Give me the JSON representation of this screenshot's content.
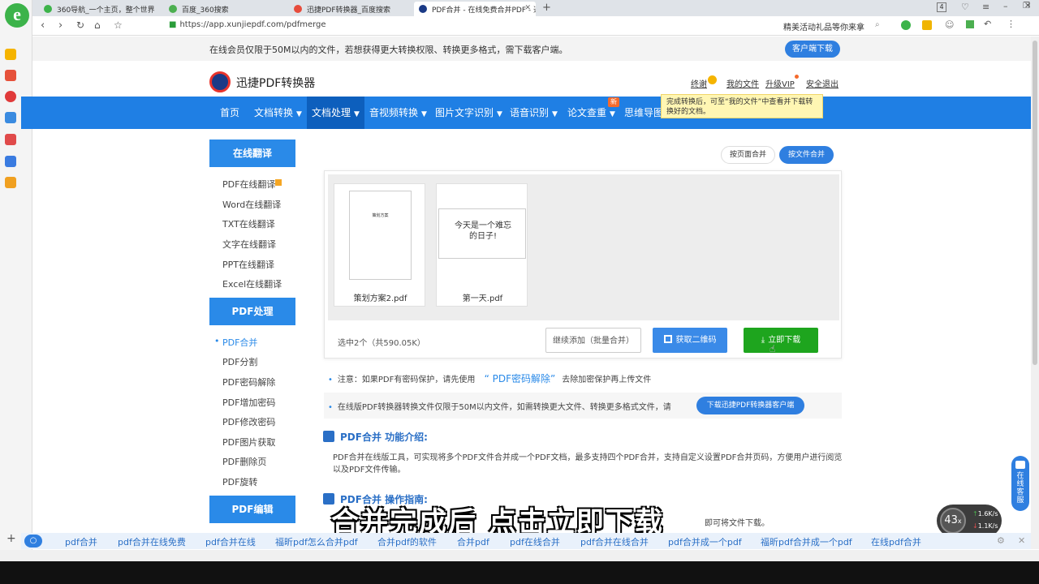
{
  "browser": {
    "tabs": [
      {
        "label": "360导航_一个主页，整个世界",
        "active": false
      },
      {
        "label": "百度_360搜索",
        "active": false
      },
      {
        "label": "迅捷PDF转换器_百度搜索",
        "active": false
      },
      {
        "label": "PDF合并 - 在线免费合并PDF - 迅",
        "active": true
      }
    ],
    "url": "https://app.xunjiepdf.com/pdfmerge",
    "right_text": "精美活动礼品等你来拿",
    "tab_count": "4"
  },
  "notice": {
    "text": "在线会员仅限于50M以内的文件，若想获得更大转换权限、转换更多格式，需下载客户端。",
    "button": "客户端下载"
  },
  "header": {
    "logo_text": "迅捷PDF转换器",
    "links": [
      "终谢",
      "我的文件",
      "升级VIP",
      "安全退出"
    ],
    "tooltip": "完成转换后，可至“我的文件”中查看并下载转换好的文档。"
  },
  "nav": {
    "items": [
      {
        "label": "首页",
        "caret": false
      },
      {
        "label": "文档转换",
        "caret": true
      },
      {
        "label": "文档处理",
        "caret": true
      },
      {
        "label": "音视频转换",
        "caret": true
      },
      {
        "label": "图片文字识别",
        "caret": true
      },
      {
        "label": "语音识别",
        "caret": true
      },
      {
        "label": "论文查重",
        "caret": true
      },
      {
        "label": "思维导图",
        "caret": false
      }
    ],
    "badge": "新"
  },
  "sidebar": {
    "sections": [
      {
        "title": "在线翻译",
        "items": [
          "PDF在线翻译",
          "Word在线翻译",
          "TXT在线翻译",
          "文字在线翻译",
          "PPT在线翻译",
          "Excel在线翻译"
        ]
      },
      {
        "title": "PDF处理",
        "items": [
          "PDF合并",
          "PDF分割",
          "PDF密码解除",
          "PDF增加密码",
          "PDF修改密码",
          "PDF图片获取",
          "PDF删除页",
          "PDF旋转"
        ]
      },
      {
        "title": "PDF编辑",
        "items": []
      }
    ],
    "active_item": "PDF合并"
  },
  "main": {
    "modes": [
      "按页面合并",
      "按文件合并"
    ],
    "files": [
      {
        "name": "策划方案2.pdf",
        "thumb_text": "策划方案"
      },
      {
        "name": "第一天.pdf",
        "thumb_text": "今天是一个难忘的日子!"
      }
    ],
    "selection_info": "选中2个（共590.05K）",
    "buttons": {
      "continue_add": "继续添加（批量合并）",
      "qr": "获取二维码",
      "download": "立即下载"
    },
    "note1_prefix": "注意：如果PDF有密码保护，请先使用",
    "note1_link": "“ PDF密码解除”",
    "note1_suffix": "去除加密保护再上传文件",
    "note2": "在线版PDF转换器转换文件仅限于50M以内文件，如需转换更大文件、转换更多格式文件，请",
    "note2_button": "下载迅捷PDF转换器客户端",
    "section1_title": "PDF合并 功能介绍:",
    "section1_body": "PDF合并在线版工具，可实现将多个PDF文件合并成一个PDF文档，最多支持四个PDF合并，支持自定义设置PDF合并页码，方便用户进行阅览以及PDF文件传输。",
    "section2_title": "PDF合并 操作指南:",
    "section2_body_partial": "即可将文件下载。"
  },
  "subtitle": "合并完成后 点击立即下载",
  "float": {
    "service": "在线客服",
    "speed_pct": "43",
    "speed_unit": "x",
    "up": "1.6K/s",
    "down": "1.1K/s"
  },
  "search_keywords": [
    "pdf合并",
    "pdf合并在线免费",
    "pdf合并在线",
    "福昕pdf怎么合并pdf",
    "合并pdf的软件",
    "合并pdf",
    "pdf在线合并",
    "pdf合并在线合并",
    "pdf合并成一个pdf",
    "福昕pdf合并成一个pdf",
    "在线pdf合并"
  ],
  "colors": {
    "primary": "#1f7fe4",
    "download": "#1ea51e",
    "accent_blue": "#2f7fe0"
  }
}
